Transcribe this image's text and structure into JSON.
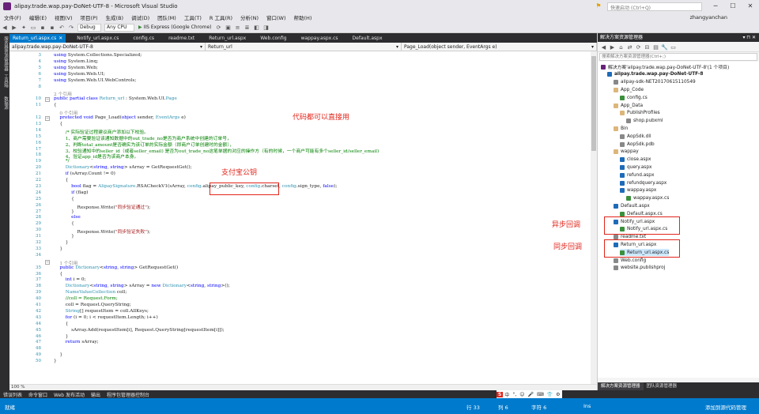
{
  "window": {
    "title": "alipay.trade.wap.pay-DoNet-UTF-8 - Microsoft Visual Studio",
    "quick_launch": "快速启动 (Ctrl+Q)",
    "user": "zhangyanchan"
  },
  "menu": [
    "文件(F)",
    "编辑(E)",
    "视图(V)",
    "项目(P)",
    "生成(B)",
    "调试(D)",
    "团队(M)",
    "工具(T)",
    "R 工具(R)",
    "分析(N)",
    "窗口(W)",
    "帮助(H)"
  ],
  "toolbar": {
    "config": "Debug",
    "platform": "Any CPU",
    "run_label": "IIS Express (Google Chrome)"
  },
  "left_rail": [
    "服务器资源管理器",
    "工具箱",
    "数据源"
  ],
  "tabs": [
    {
      "label": "Return_url.aspx.cs",
      "active": true
    },
    {
      "label": "Notify_url.aspx.cs",
      "active": false
    },
    {
      "label": "config.cs",
      "active": false
    },
    {
      "label": "readme.txt",
      "active": false
    },
    {
      "label": "Return_url.aspx",
      "active": false
    },
    {
      "label": "Web.config",
      "active": false
    },
    {
      "label": "wappay.aspx.cs",
      "active": false
    },
    {
      "label": "Default.aspx",
      "active": false
    }
  ],
  "nav": {
    "project": "alipay.trade.wap.pay-DoNet-UTF-8",
    "class": "Return_url",
    "member": "Page_Load(object sender, EventArgs e)"
  },
  "code_lines": [
    {
      "n": "3",
      "t": [
        [
          "using ",
          "kw"
        ],
        [
          "System.Collections.Specialized",
          ""
        ],
        [
          ";",
          ""
        ]
      ]
    },
    {
      "n": "4",
      "t": [
        [
          "using ",
          "kw"
        ],
        [
          "System.Linq",
          ""
        ],
        [
          ";",
          ""
        ]
      ]
    },
    {
      "n": "5",
      "t": [
        [
          "using ",
          "kw"
        ],
        [
          "System.Web",
          ""
        ],
        [
          ";",
          ""
        ]
      ]
    },
    {
      "n": "6",
      "t": [
        [
          "using ",
          "kw"
        ],
        [
          "System.Web.UI",
          ""
        ],
        [
          ";",
          ""
        ]
      ]
    },
    {
      "n": "7",
      "t": [
        [
          "using ",
          "kw"
        ],
        [
          "System.Web.UI.WebControls",
          ""
        ],
        [
          ";",
          ""
        ]
      ]
    },
    {
      "n": "8",
      "t": []
    },
    {
      "n": "",
      "t": [
        [
          "2 个引用",
          "rf"
        ]
      ]
    },
    {
      "n": "10",
      "t": [
        [
          "public partial class ",
          "kw"
        ],
        [
          "Return_url",
          "ty"
        ],
        [
          " : System.Web.UI.",
          ""
        ],
        [
          "Page",
          "ty"
        ]
      ]
    },
    {
      "n": "11",
      "t": [
        [
          "{",
          ""
        ]
      ]
    },
    {
      "n": "",
      "t": [
        [
          "    0 个引用",
          "rf"
        ]
      ]
    },
    {
      "n": "12",
      "t": [
        [
          "    protected void ",
          "kw"
        ],
        [
          "Page_Load(",
          ""
        ],
        [
          "object ",
          "kw"
        ],
        [
          "sender, ",
          ""
        ],
        [
          "EventArgs ",
          "ty"
        ],
        [
          "e)",
          ""
        ]
      ]
    },
    {
      "n": "13",
      "t": [
        [
          "    {",
          ""
        ]
      ]
    },
    {
      "n": "14",
      "t": [
        [
          "        /* 实际验证过程建议商户添加以下校验。",
          "cm"
        ]
      ]
    },
    {
      "n": "15",
      "t": [
        [
          "        1、商户需要验证该通知数据中的out_trade_no是否为商户系统中创建的订单号，",
          "cm"
        ]
      ]
    },
    {
      "n": "16",
      "t": [
        [
          "        2、判断total_amount是否确实为该订单的实际金额（即商户订单创建时的金额），",
          "cm"
        ]
      ]
    },
    {
      "n": "17",
      "t": [
        [
          "        3、校验通知中的seller_id（或者seller_email) 是否为out_trade_no这笔单据的对应的操作方（有的时候，一个商户可能有多个seller_id/seller_email)",
          "cm"
        ]
      ]
    },
    {
      "n": "18",
      "t": [
        [
          "        4、验证app_id是否为该商户本身。",
          "cm"
        ]
      ]
    },
    {
      "n": "19",
      "t": [
        [
          "        */",
          "cm"
        ]
      ]
    },
    {
      "n": "20",
      "t": [
        [
          "        ",
          ""
        ],
        [
          "Dictionary",
          "ty"
        ],
        [
          "<",
          ""
        ],
        [
          "string",
          "kw"
        ],
        [
          ", ",
          ""
        ],
        [
          "string",
          "kw"
        ],
        [
          "> sArray = GetRequestGet();",
          ""
        ]
      ]
    },
    {
      "n": "21",
      "t": [
        [
          "        ",
          ""
        ],
        [
          "if",
          "kw"
        ],
        [
          " (sArray.Count != 0)",
          ""
        ]
      ]
    },
    {
      "n": "22",
      "t": [
        [
          "        {",
          ""
        ]
      ]
    },
    {
      "n": "23",
      "t": [
        [
          "            ",
          ""
        ],
        [
          "bool",
          "kw"
        ],
        [
          " flag = ",
          ""
        ],
        [
          "AlipaySignature",
          "ty"
        ],
        [
          ".RSACheckV1(sArray, ",
          ""
        ],
        [
          "config",
          "ty"
        ],
        [
          ".alipay_public_key, ",
          ""
        ],
        [
          "config",
          "ty"
        ],
        [
          ".charset, ",
          ""
        ],
        [
          "config",
          "ty"
        ],
        [
          ".sign_type, ",
          ""
        ],
        [
          "false",
          "kw"
        ],
        [
          ");",
          ""
        ]
      ]
    },
    {
      "n": "24",
      "t": [
        [
          "            ",
          ""
        ],
        [
          "if",
          "kw"
        ],
        [
          " (flag)",
          ""
        ]
      ]
    },
    {
      "n": "25",
      "t": [
        [
          "            {",
          ""
        ]
      ]
    },
    {
      "n": "26",
      "t": [
        [
          "                Response.Write(",
          ""
        ],
        [
          "\"同步验证通过\"",
          "st"
        ],
        [
          ");",
          ""
        ]
      ]
    },
    {
      "n": "27",
      "t": [
        [
          "            }",
          ""
        ]
      ]
    },
    {
      "n": "28",
      "t": [
        [
          "            ",
          ""
        ],
        [
          "else",
          "kw"
        ]
      ]
    },
    {
      "n": "29",
      "t": [
        [
          "            {",
          ""
        ]
      ]
    },
    {
      "n": "30",
      "t": [
        [
          "                Response.Write(",
          ""
        ],
        [
          "\"同步验证失败\"",
          "st"
        ],
        [
          ");",
          ""
        ]
      ]
    },
    {
      "n": "31",
      "t": [
        [
          "            }",
          ""
        ]
      ]
    },
    {
      "n": "32",
      "t": [
        [
          "        }",
          ""
        ]
      ]
    },
    {
      "n": "33",
      "t": [
        [
          "    }",
          ""
        ]
      ]
    },
    {
      "n": "34",
      "t": []
    },
    {
      "n": "",
      "t": [
        [
          "    1 个引用",
          "rf"
        ]
      ]
    },
    {
      "n": "35",
      "t": [
        [
          "    public ",
          "kw"
        ],
        [
          "Dictionary",
          "ty"
        ],
        [
          "<",
          ""
        ],
        [
          "string",
          "kw"
        ],
        [
          ", ",
          ""
        ],
        [
          "string",
          "kw"
        ],
        [
          "> GetRequestGet()",
          ""
        ]
      ]
    },
    {
      "n": "36",
      "t": [
        [
          "    {",
          ""
        ]
      ]
    },
    {
      "n": "37",
      "t": [
        [
          "        ",
          ""
        ],
        [
          "int",
          "kw"
        ],
        [
          " i = 0;",
          ""
        ]
      ]
    },
    {
      "n": "38",
      "t": [
        [
          "        ",
          ""
        ],
        [
          "Dictionary",
          "ty"
        ],
        [
          "<",
          ""
        ],
        [
          "string",
          "kw"
        ],
        [
          ", ",
          ""
        ],
        [
          "string",
          "kw"
        ],
        [
          "> sArray = ",
          ""
        ],
        [
          "new ",
          "kw"
        ],
        [
          "Dictionary",
          "ty"
        ],
        [
          "<",
          ""
        ],
        [
          "string",
          "kw"
        ],
        [
          ", ",
          ""
        ],
        [
          "string",
          "kw"
        ],
        [
          ">();",
          ""
        ]
      ]
    },
    {
      "n": "39",
      "t": [
        [
          "        ",
          ""
        ],
        [
          "NameValueCollection",
          "ty"
        ],
        [
          " coll;",
          ""
        ]
      ]
    },
    {
      "n": "40",
      "t": [
        [
          "        //coll = Request.Form;",
          "cm"
        ]
      ]
    },
    {
      "n": "41",
      "t": [
        [
          "        coll = Request.QueryString;",
          ""
        ]
      ]
    },
    {
      "n": "42",
      "t": [
        [
          "        ",
          ""
        ],
        [
          "String",
          "ty"
        ],
        [
          "[] requestItem = coll.AllKeys;",
          ""
        ]
      ]
    },
    {
      "n": "43",
      "t": [
        [
          "        ",
          ""
        ],
        [
          "for",
          "kw"
        ],
        [
          " (i = 0; i < requestItem.Length; i++)",
          ""
        ]
      ]
    },
    {
      "n": "44",
      "t": [
        [
          "        {",
          ""
        ]
      ]
    },
    {
      "n": "45",
      "t": [
        [
          "            sArray.Add(requestItem[i], Request.QueryString[requestItem[i]]);",
          ""
        ]
      ]
    },
    {
      "n": "46",
      "t": [
        [
          "        }",
          ""
        ]
      ]
    },
    {
      "n": "47",
      "t": [
        [
          "        ",
          ""
        ],
        [
          "return",
          "kw"
        ],
        [
          " sArray;",
          ""
        ]
      ]
    },
    {
      "n": "48",
      "t": []
    },
    {
      "n": "49",
      "t": [
        [
          "    }",
          ""
        ]
      ]
    },
    {
      "n": "50",
      "t": [
        [
          "}",
          ""
        ]
      ]
    }
  ],
  "annotations": {
    "code_note": "代码都可以直接用",
    "key_note": "支付宝公钥",
    "async_note": "异步回调",
    "sync_note": "同步回调"
  },
  "zoom": "100 %",
  "solution": {
    "header": "解决方案资源管理器",
    "search_placeholder": "搜索解决方案资源管理器(Ctrl+;)",
    "items": [
      {
        "label": "解决方案'alipay.trade.wap.pay-DoNet-UTF-8'(1 个项目)",
        "indent": 0,
        "icon": "#68217a"
      },
      {
        "label": "alipay.trade.wap.pay-DoNet-UTF-8",
        "indent": 1,
        "icon": "#1e6bb8",
        "bold": true
      },
      {
        "label": "alipay-sdk-NET20170615110549",
        "indent": 2,
        "icon": "#888888"
      },
      {
        "label": "App_Code",
        "indent": 2,
        "icon": "#dcb67a"
      },
      {
        "label": "config.cs",
        "indent": 3,
        "icon": "#3c8f3c"
      },
      {
        "label": "App_Data",
        "indent": 2,
        "icon": "#dcb67a"
      },
      {
        "label": "PublishProfiles",
        "indent": 3,
        "icon": "#dcb67a"
      },
      {
        "label": "shop.pubxml",
        "indent": 4,
        "icon": "#888888"
      },
      {
        "label": "Bin",
        "indent": 2,
        "icon": "#dcb67a"
      },
      {
        "label": "AopSdk.dll",
        "indent": 3,
        "icon": "#888888"
      },
      {
        "label": "AopSdk.pdb",
        "indent": 3,
        "icon": "#888888"
      },
      {
        "label": "wappay",
        "indent": 2,
        "icon": "#dcb67a"
      },
      {
        "label": "close.aspx",
        "indent": 3,
        "icon": "#1e6bb8"
      },
      {
        "label": "query.aspx",
        "indent": 3,
        "icon": "#1e6bb8"
      },
      {
        "label": "refund.aspx",
        "indent": 3,
        "icon": "#1e6bb8"
      },
      {
        "label": "refundquery.aspx",
        "indent": 3,
        "icon": "#1e6bb8"
      },
      {
        "label": "wappay.aspx",
        "indent": 3,
        "icon": "#1e6bb8"
      },
      {
        "label": "wappay.aspx.cs",
        "indent": 4,
        "icon": "#3c8f3c"
      },
      {
        "label": "Default.aspx",
        "indent": 2,
        "icon": "#1e6bb8"
      },
      {
        "label": "Default.aspx.cs",
        "indent": 3,
        "icon": "#3c8f3c"
      },
      {
        "label": "Notify_url.aspx",
        "indent": 2,
        "icon": "#1e6bb8"
      },
      {
        "label": "Notify_url.aspx.cs",
        "indent": 3,
        "icon": "#3c8f3c"
      },
      {
        "label": "readme.txt",
        "indent": 2,
        "icon": "#888888"
      },
      {
        "label": "Return_url.aspx",
        "indent": 2,
        "icon": "#1e6bb8"
      },
      {
        "label": "Return_url.aspx.cs",
        "indent": 3,
        "icon": "#3c8f3c",
        "selected": true
      },
      {
        "label": "Web.config",
        "indent": 2,
        "icon": "#888888"
      },
      {
        "label": "website.publishproj",
        "indent": 2,
        "icon": "#888888"
      }
    ],
    "bottom_tabs": [
      "解决方案资源管理器",
      "团队资源管理器"
    ]
  },
  "bottom_tabs": [
    "错误列表",
    "命令窗口",
    "Web 发布活动",
    "输出",
    "程序包管理器控制台"
  ],
  "ime": [
    "S",
    "中",
    "°,",
    "☺",
    "🎤",
    "⌨",
    "👕",
    "⚙"
  ],
  "status": {
    "ready": "就绪",
    "line": "行 33",
    "col": "列 6",
    "char": "字符 6",
    "ins": "Ins",
    "source_control": "添加到源代码管理"
  }
}
